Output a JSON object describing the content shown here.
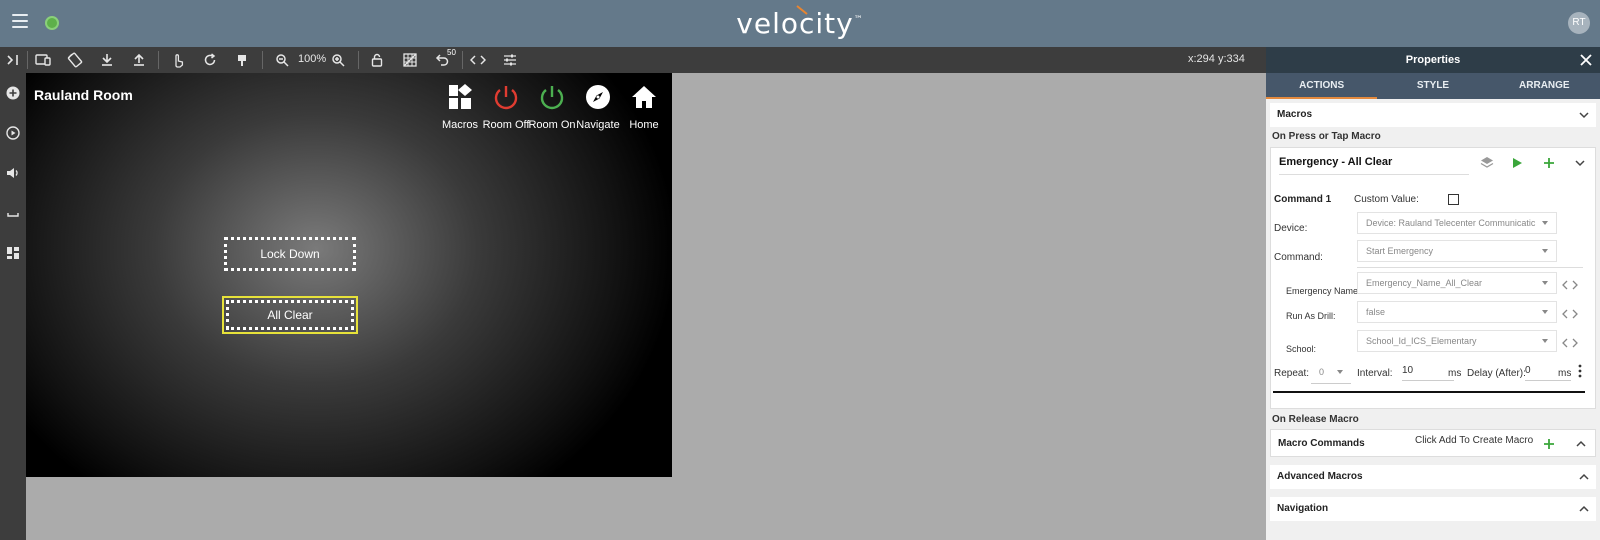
{
  "header": {
    "logo_text": "velocity",
    "logo_tm": "™",
    "avatar_initials": "RT"
  },
  "toolbar": {
    "zoom_level": "100%",
    "undo_count": "50",
    "cursor_coords": "x:294 y:334"
  },
  "canvas": {
    "room_title": "Rauland Room",
    "nav": [
      {
        "label": "Macros",
        "icon": "macros-icon",
        "color": "#ffffff"
      },
      {
        "label": "Room Off",
        "icon": "power-icon",
        "color": "#e03c31"
      },
      {
        "label": "Room On",
        "icon": "power-icon",
        "color": "#4caf50"
      },
      {
        "label": "Navigate",
        "icon": "compass-icon",
        "color": "#ffffff"
      },
      {
        "label": "Home",
        "icon": "home-icon",
        "color": "#ffffff"
      }
    ],
    "buttons": {
      "lock_down": "Lock Down",
      "all_clear": "All Clear"
    }
  },
  "properties": {
    "title": "Properties",
    "tabs": [
      "ACTIONS",
      "STYLE",
      "ARRANGE"
    ],
    "active_tab": "ACTIONS",
    "macros_section": "Macros",
    "on_press_label": "On Press or Tap Macro",
    "macro": {
      "name": "Emergency -  All Clear",
      "command_label": "Command 1",
      "custom_value_label": "Custom Value:",
      "device_label": "Device:",
      "device_value": "Device: Rauland Telecenter Communicatic",
      "command_field_label": "Command:",
      "command_value": "Start Emergency",
      "params": [
        {
          "label": "Emergency Name:",
          "value": "Emergency_Name_All_Clear"
        },
        {
          "label": "Run As Drill:",
          "value": "false"
        },
        {
          "label": "School:",
          "value": "School_Id_ICS_Elementary"
        }
      ],
      "repeat_label": "Repeat:",
      "repeat_value": "0",
      "interval_label": "Interval:",
      "interval_value": "10",
      "interval_unit": "ms",
      "delay_label": "Delay (After):",
      "delay_value": "0",
      "delay_unit": "ms"
    },
    "on_release_label": "On Release Macro",
    "macro_commands_label": "Macro Commands",
    "click_add_hint": "Click Add To Create Macro",
    "advanced_macros": "Advanced Macros",
    "navigation": "Navigation"
  },
  "colors": {
    "header_bg": "#64798a",
    "toolbar_bg": "#3d3d3d",
    "selected_border": "#e7e23a",
    "tab_active_underline": "#e48a3e",
    "play_green": "#3aa63a"
  }
}
